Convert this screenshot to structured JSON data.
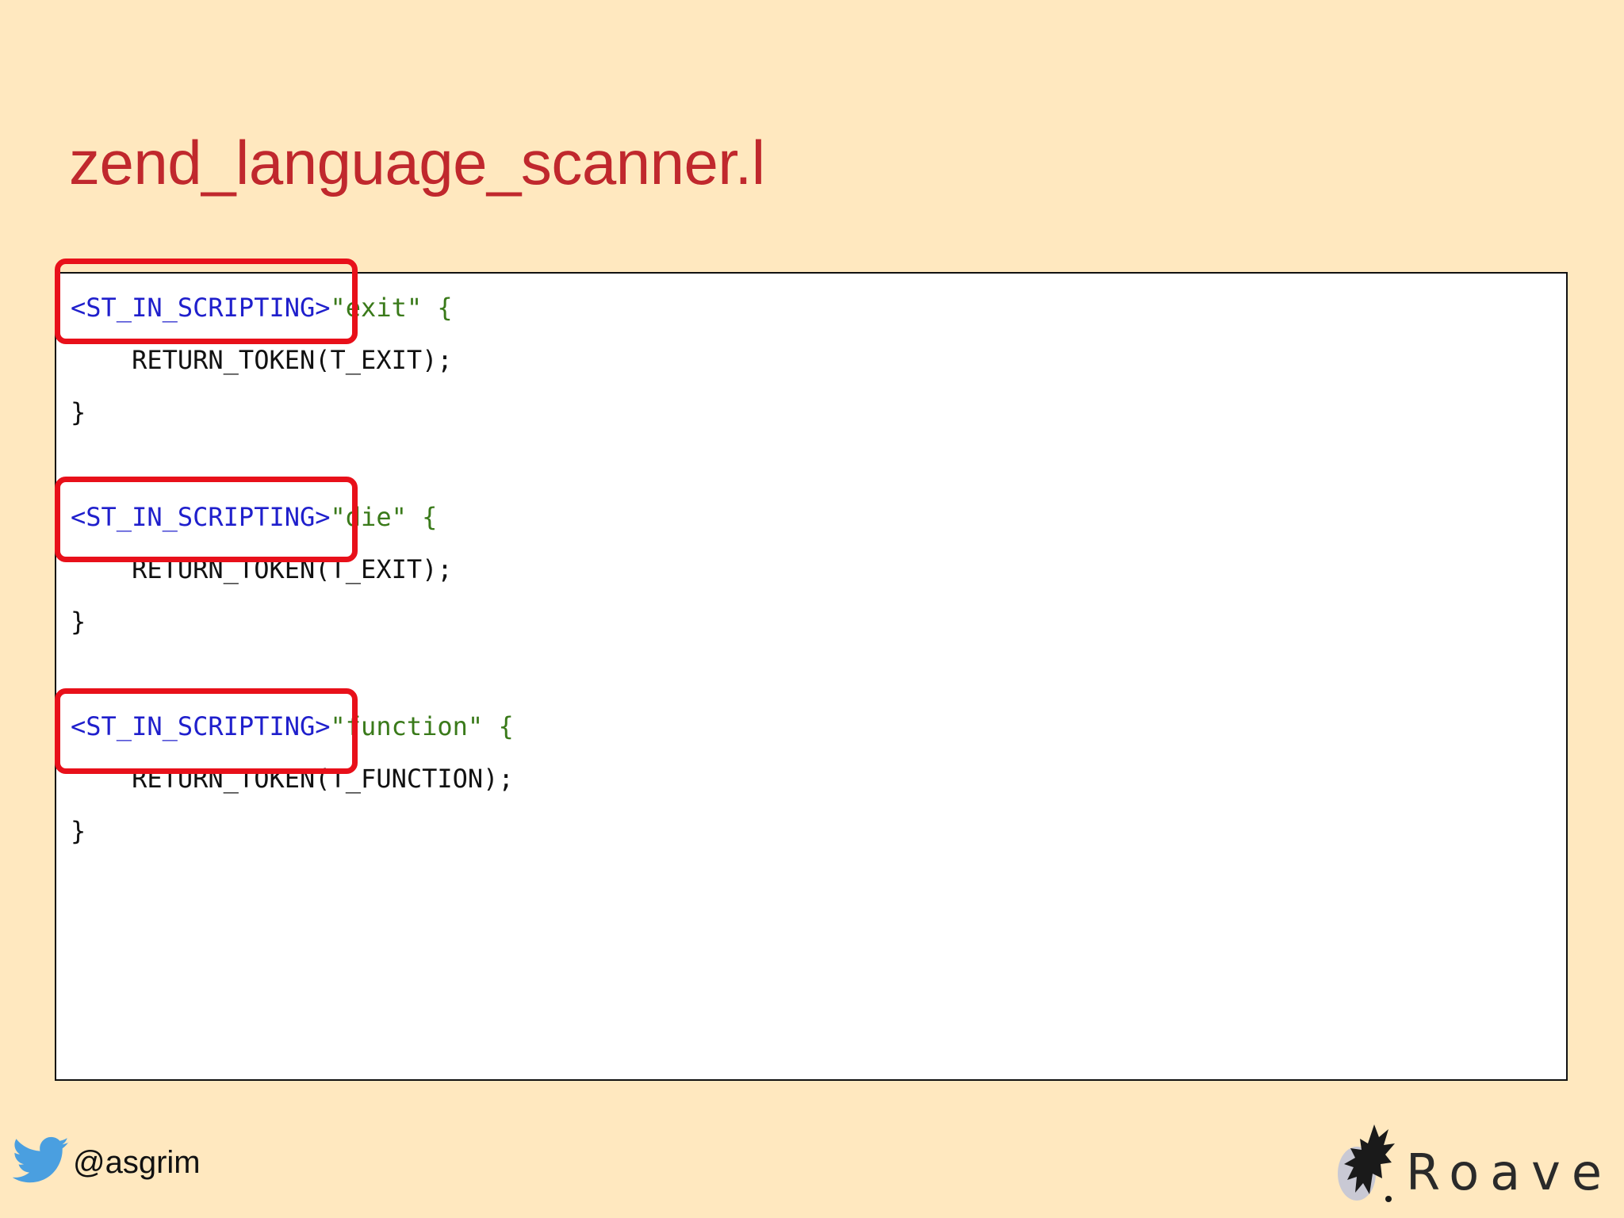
{
  "slide": {
    "title": "zend_language_scanner.l"
  },
  "code": {
    "blocks": [
      {
        "tag": "<ST_IN_SCRIPTING>",
        "quote": "\"",
        "keyword": "exit",
        "open": "\" {",
        "body": "    RETURN_TOKEN(T_EXIT);",
        "close": "}"
      },
      {
        "tag": "<ST_IN_SCRIPTING>",
        "quote": "\"",
        "keyword": "die",
        "open": "\" {",
        "body": "    RETURN_TOKEN(T_EXIT);",
        "close": "}"
      },
      {
        "tag": "<ST_IN_SCRIPTING>",
        "quote": "\"",
        "keyword": "function",
        "open": "\" {",
        "body": "    RETURN_TOKEN(T_FUNCTION);",
        "close": "}"
      }
    ]
  },
  "footer": {
    "twitter_icon": "twitter-bird-icon",
    "handle": "@asgrim",
    "logo_icon": "roave-mark-icon",
    "logo_text": "Roave"
  },
  "colors": {
    "background": "#FFE8BF",
    "title": "#C0282D",
    "tag": "#1F1FCC",
    "string": "#3A7A1A",
    "highlight": "#E8101A",
    "twitter": "#4A9FE0"
  }
}
